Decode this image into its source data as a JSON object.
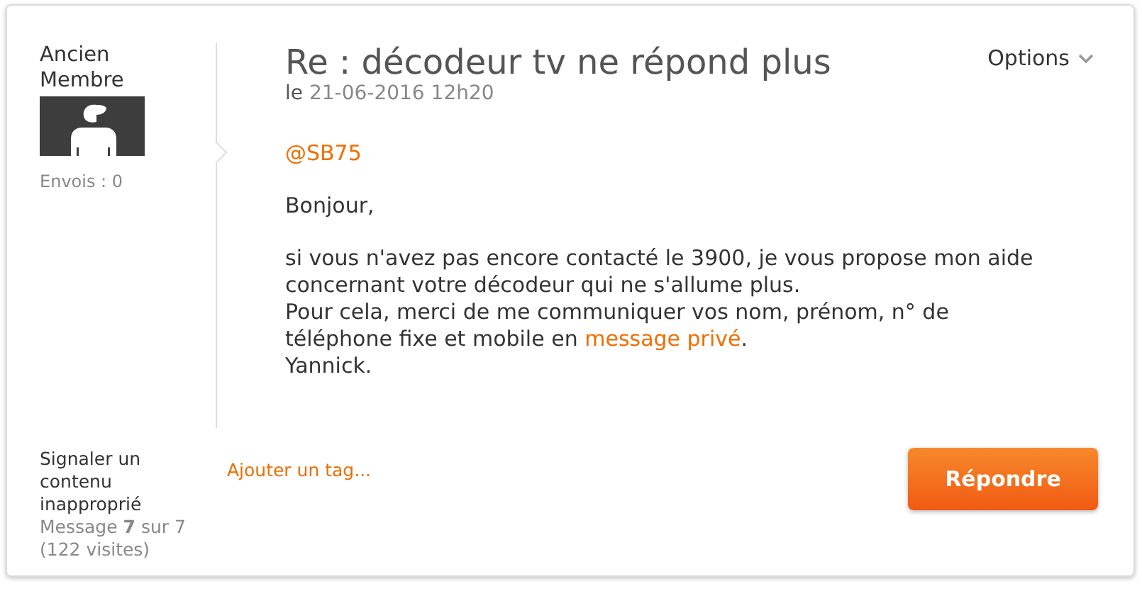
{
  "author": {
    "name": "Ancien Membre",
    "posts": "Envois : 0"
  },
  "post": {
    "title": "Re : décodeur tv ne répond plus",
    "date_prefix": "le",
    "date": "21-06-2016 12h20",
    "options": "Options",
    "mention": "@SB75",
    "paragraphs": [
      {
        "kind": "text",
        "text": "Bonjour,"
      },
      {
        "kind": "text",
        "text": "si vous n'avez pas encore contacté le 3900, je vous propose mon aide concernant votre décodeur qui ne s'allume plus."
      },
      {
        "kind": "link",
        "before": "Pour cela, merci de me communiquer vos nom, prénom, n° de téléphone fixe et mobile en ",
        "link": "message privé",
        "after": ".",
        "next_line": "Yannick."
      }
    ]
  },
  "footer": {
    "report": "Signaler un contenu inapproprié",
    "message_count": "Message **7** sur 7",
    "visits": "(122 visites)",
    "add_tag": "Ajouter un tag...",
    "reply": "Répondre"
  }
}
